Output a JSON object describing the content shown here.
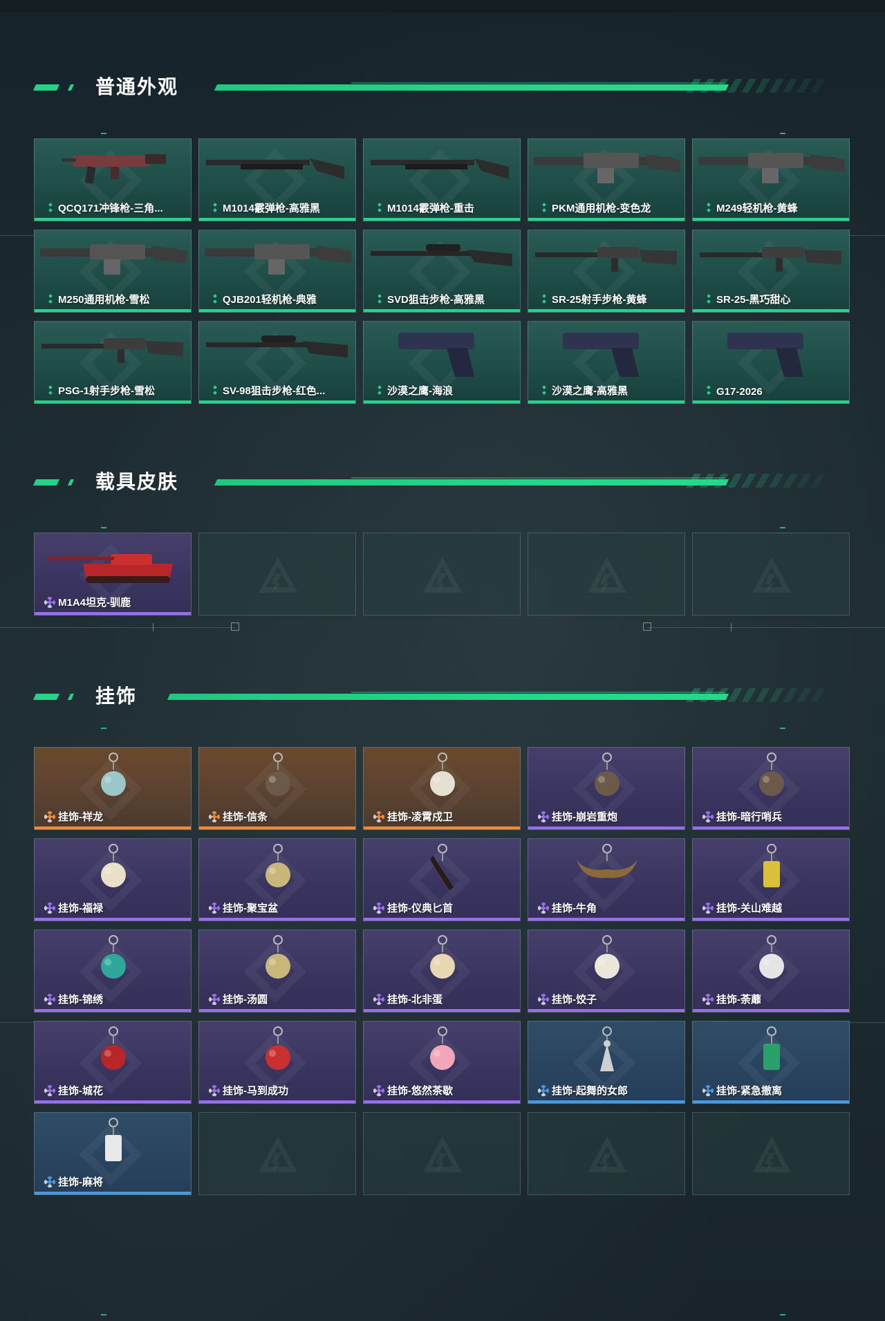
{
  "sections": {
    "weapons": {
      "title": "普通外观",
      "items": [
        {
          "label": "QCQ171冲锋枪-三角...",
          "rarity": "green",
          "icon": "smg-icon"
        },
        {
          "label": "M1014霰弹枪-高雅黑",
          "rarity": "green",
          "icon": "shotgun-icon"
        },
        {
          "label": "M1014霰弹枪-重击",
          "rarity": "green",
          "icon": "shotgun-icon"
        },
        {
          "label": "PKM通用机枪-变色龙",
          "rarity": "green",
          "icon": "machine-gun-icon"
        },
        {
          "label": "M249轻机枪-黄蜂",
          "rarity": "green",
          "icon": "machine-gun-icon"
        },
        {
          "label": "M250通用机枪-雪松",
          "rarity": "green",
          "icon": "machine-gun-icon"
        },
        {
          "label": "QJB201轻机枪-典雅",
          "rarity": "green",
          "icon": "machine-gun-icon"
        },
        {
          "label": "SVD狙击步枪-高雅黑",
          "rarity": "green",
          "icon": "sniper-rifle-icon"
        },
        {
          "label": "SR-25射手步枪-黄蜂",
          "rarity": "green",
          "icon": "rifle-icon"
        },
        {
          "label": "SR-25-黑巧甜心",
          "rarity": "green",
          "icon": "rifle-icon"
        },
        {
          "label": "PSG-1射手步枪-雪松",
          "rarity": "green",
          "icon": "rifle-icon"
        },
        {
          "label": "SV-98狙击步枪-红色...",
          "rarity": "green",
          "icon": "sniper-rifle-icon"
        },
        {
          "label": "沙漠之鹰-海浪",
          "rarity": "green",
          "icon": "pistol-icon"
        },
        {
          "label": "沙漠之鹰-高雅黑",
          "rarity": "green",
          "icon": "pistol-icon"
        },
        {
          "label": "G17-2026",
          "rarity": "green",
          "icon": "pistol-icon"
        }
      ]
    },
    "vehicles": {
      "title": "载具皮肤",
      "items": [
        {
          "label": "M1A4坦克-驯鹿",
          "rarity": "purple",
          "icon": "tank-icon"
        }
      ],
      "empty_slots": 4
    },
    "charms": {
      "title": "挂饰",
      "items": [
        {
          "label": "挂饰-祥龙",
          "rarity": "orange",
          "icon": "dragon-charm-icon"
        },
        {
          "label": "挂饰-信条",
          "rarity": "orange",
          "icon": "figure-charm-icon"
        },
        {
          "label": "挂饰-凌霄戍卫",
          "rarity": "orange",
          "icon": "bird-charm-icon"
        },
        {
          "label": "挂饰-崩岩重炮",
          "rarity": "purple",
          "icon": "figure-charm-icon"
        },
        {
          "label": "挂饰-暗行哨兵",
          "rarity": "purple",
          "icon": "figure-charm-icon"
        },
        {
          "label": "挂饰-福禄",
          "rarity": "purple",
          "icon": "gourd-charm-icon"
        },
        {
          "label": "挂饰-聚宝盆",
          "rarity": "purple",
          "icon": "bowl-charm-icon"
        },
        {
          "label": "挂饰-仪典匕首",
          "rarity": "purple",
          "icon": "dagger-charm-icon"
        },
        {
          "label": "挂饰-牛角",
          "rarity": "purple",
          "icon": "horns-charm-icon"
        },
        {
          "label": "挂饰-关山难越",
          "rarity": "purple",
          "icon": "cylinder-charm-icon"
        },
        {
          "label": "挂饰-锦绣",
          "rarity": "purple",
          "icon": "butterfly-charm-icon"
        },
        {
          "label": "挂饰-汤圆",
          "rarity": "purple",
          "icon": "bowl-charm-icon"
        },
        {
          "label": "挂饰-北非蛋",
          "rarity": "purple",
          "icon": "egg-charm-icon"
        },
        {
          "label": "挂饰-饺子",
          "rarity": "purple",
          "icon": "dumpling-charm-icon"
        },
        {
          "label": "挂饰-荼蘼",
          "rarity": "purple",
          "icon": "flower-charm-icon"
        },
        {
          "label": "挂饰-城花",
          "rarity": "purple",
          "icon": "rose-charm-icon"
        },
        {
          "label": "挂饰-马到成功",
          "rarity": "purple",
          "icon": "horse-charm-icon"
        },
        {
          "label": "挂饰-悠然茶歇",
          "rarity": "purple",
          "icon": "cupcake-charm-icon"
        },
        {
          "label": "挂饰-起舞的女郎",
          "rarity": "blue",
          "icon": "dancer-charm-icon"
        },
        {
          "label": "挂饰-紧急撤离",
          "rarity": "blue",
          "icon": "sign-charm-icon"
        },
        {
          "label": "挂饰-麻将",
          "rarity": "blue",
          "icon": "mahjong-charm-icon"
        }
      ],
      "empty_slots": 4
    }
  },
  "colors": {
    "accent_green": "#25d88a",
    "rarity_green": "#27d38a",
    "rarity_purple": "#9a6ee8",
    "rarity_orange": "#f08a3a",
    "rarity_blue": "#4a98e0"
  }
}
